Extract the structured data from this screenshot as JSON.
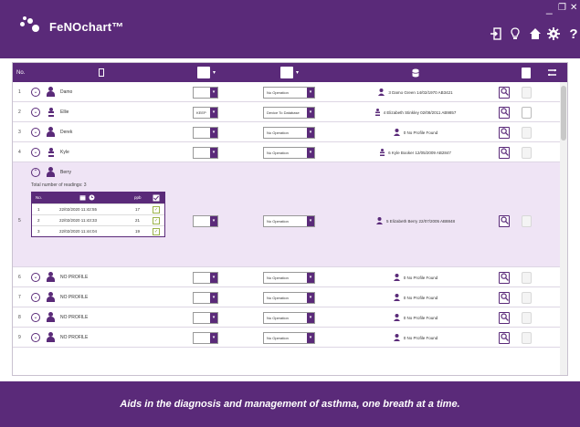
{
  "app": {
    "title": "FeNOchart™"
  },
  "window_controls": {
    "minimize": "_",
    "restore": "❐",
    "close": "✕"
  },
  "header_icons": [
    "logout-icon",
    "lightbulb-icon",
    "home-icon",
    "settings-icon",
    "help-icon"
  ],
  "help_glyph": "?",
  "table": {
    "header": {
      "no": "No."
    },
    "rows": [
      {
        "num": "1",
        "name": "Damo",
        "sel1": "",
        "operation": "No Operation",
        "profile": "3 Damo Green 14/02/1970 AB3421",
        "type": "adult"
      },
      {
        "num": "2",
        "name": "Ellie",
        "sel1": "KEEP",
        "operation": "Device To Database",
        "profile": "4 Elizabeth Stinkley 02/08/2011 AB9857",
        "type": "child"
      },
      {
        "num": "3",
        "name": "Derek",
        "sel1": "",
        "operation": "No Operation",
        "profile": "0 No Profile Found",
        "type": "adult"
      },
      {
        "num": "4",
        "name": "Kyle",
        "sel1": "",
        "operation": "No Operation",
        "profile": "6 Kyle Booker 12/05/2009 AB2847",
        "type": "child"
      },
      {
        "num": "5",
        "name": "Berry",
        "sel1": "",
        "operation": "No Operation",
        "profile": "5 Elizabeth Berry 22/07/2005 AB8848",
        "type": "adult",
        "readings_label": "Total number of readings: 3",
        "readings_header": {
          "no": "No.",
          "ppb": "ppb"
        },
        "readings": [
          {
            "no": "1",
            "datetime": "22/02/2020 11:42:55",
            "value": "17"
          },
          {
            "no": "2",
            "datetime": "22/02/2020 11:43:33",
            "value": "21"
          },
          {
            "no": "3",
            "datetime": "22/02/2020 11:44:04",
            "value": "19"
          }
        ]
      },
      {
        "num": "6",
        "name": "NO PROFILE",
        "sel1": "",
        "operation": "No Operation",
        "profile": "0 No Profile Found",
        "type": "none"
      },
      {
        "num": "7",
        "name": "NO PROFILE",
        "sel1": "",
        "operation": "No Operation",
        "profile": "0 No Profile Found",
        "type": "none"
      },
      {
        "num": "8",
        "name": "NO PROFILE",
        "sel1": "",
        "operation": "No Operation",
        "profile": "0 No Profile Found",
        "type": "none"
      },
      {
        "num": "9",
        "name": "NO PROFILE",
        "sel1": "",
        "operation": "No Operation",
        "profile": "0 No Profile Found",
        "type": "none"
      }
    ]
  },
  "footer": {
    "tagline": "Aids in the diagnosis and management of asthma, one breath at a time."
  },
  "colors": {
    "brand_purple": "#5a2a79",
    "expanded_row": "#efe4f5"
  }
}
